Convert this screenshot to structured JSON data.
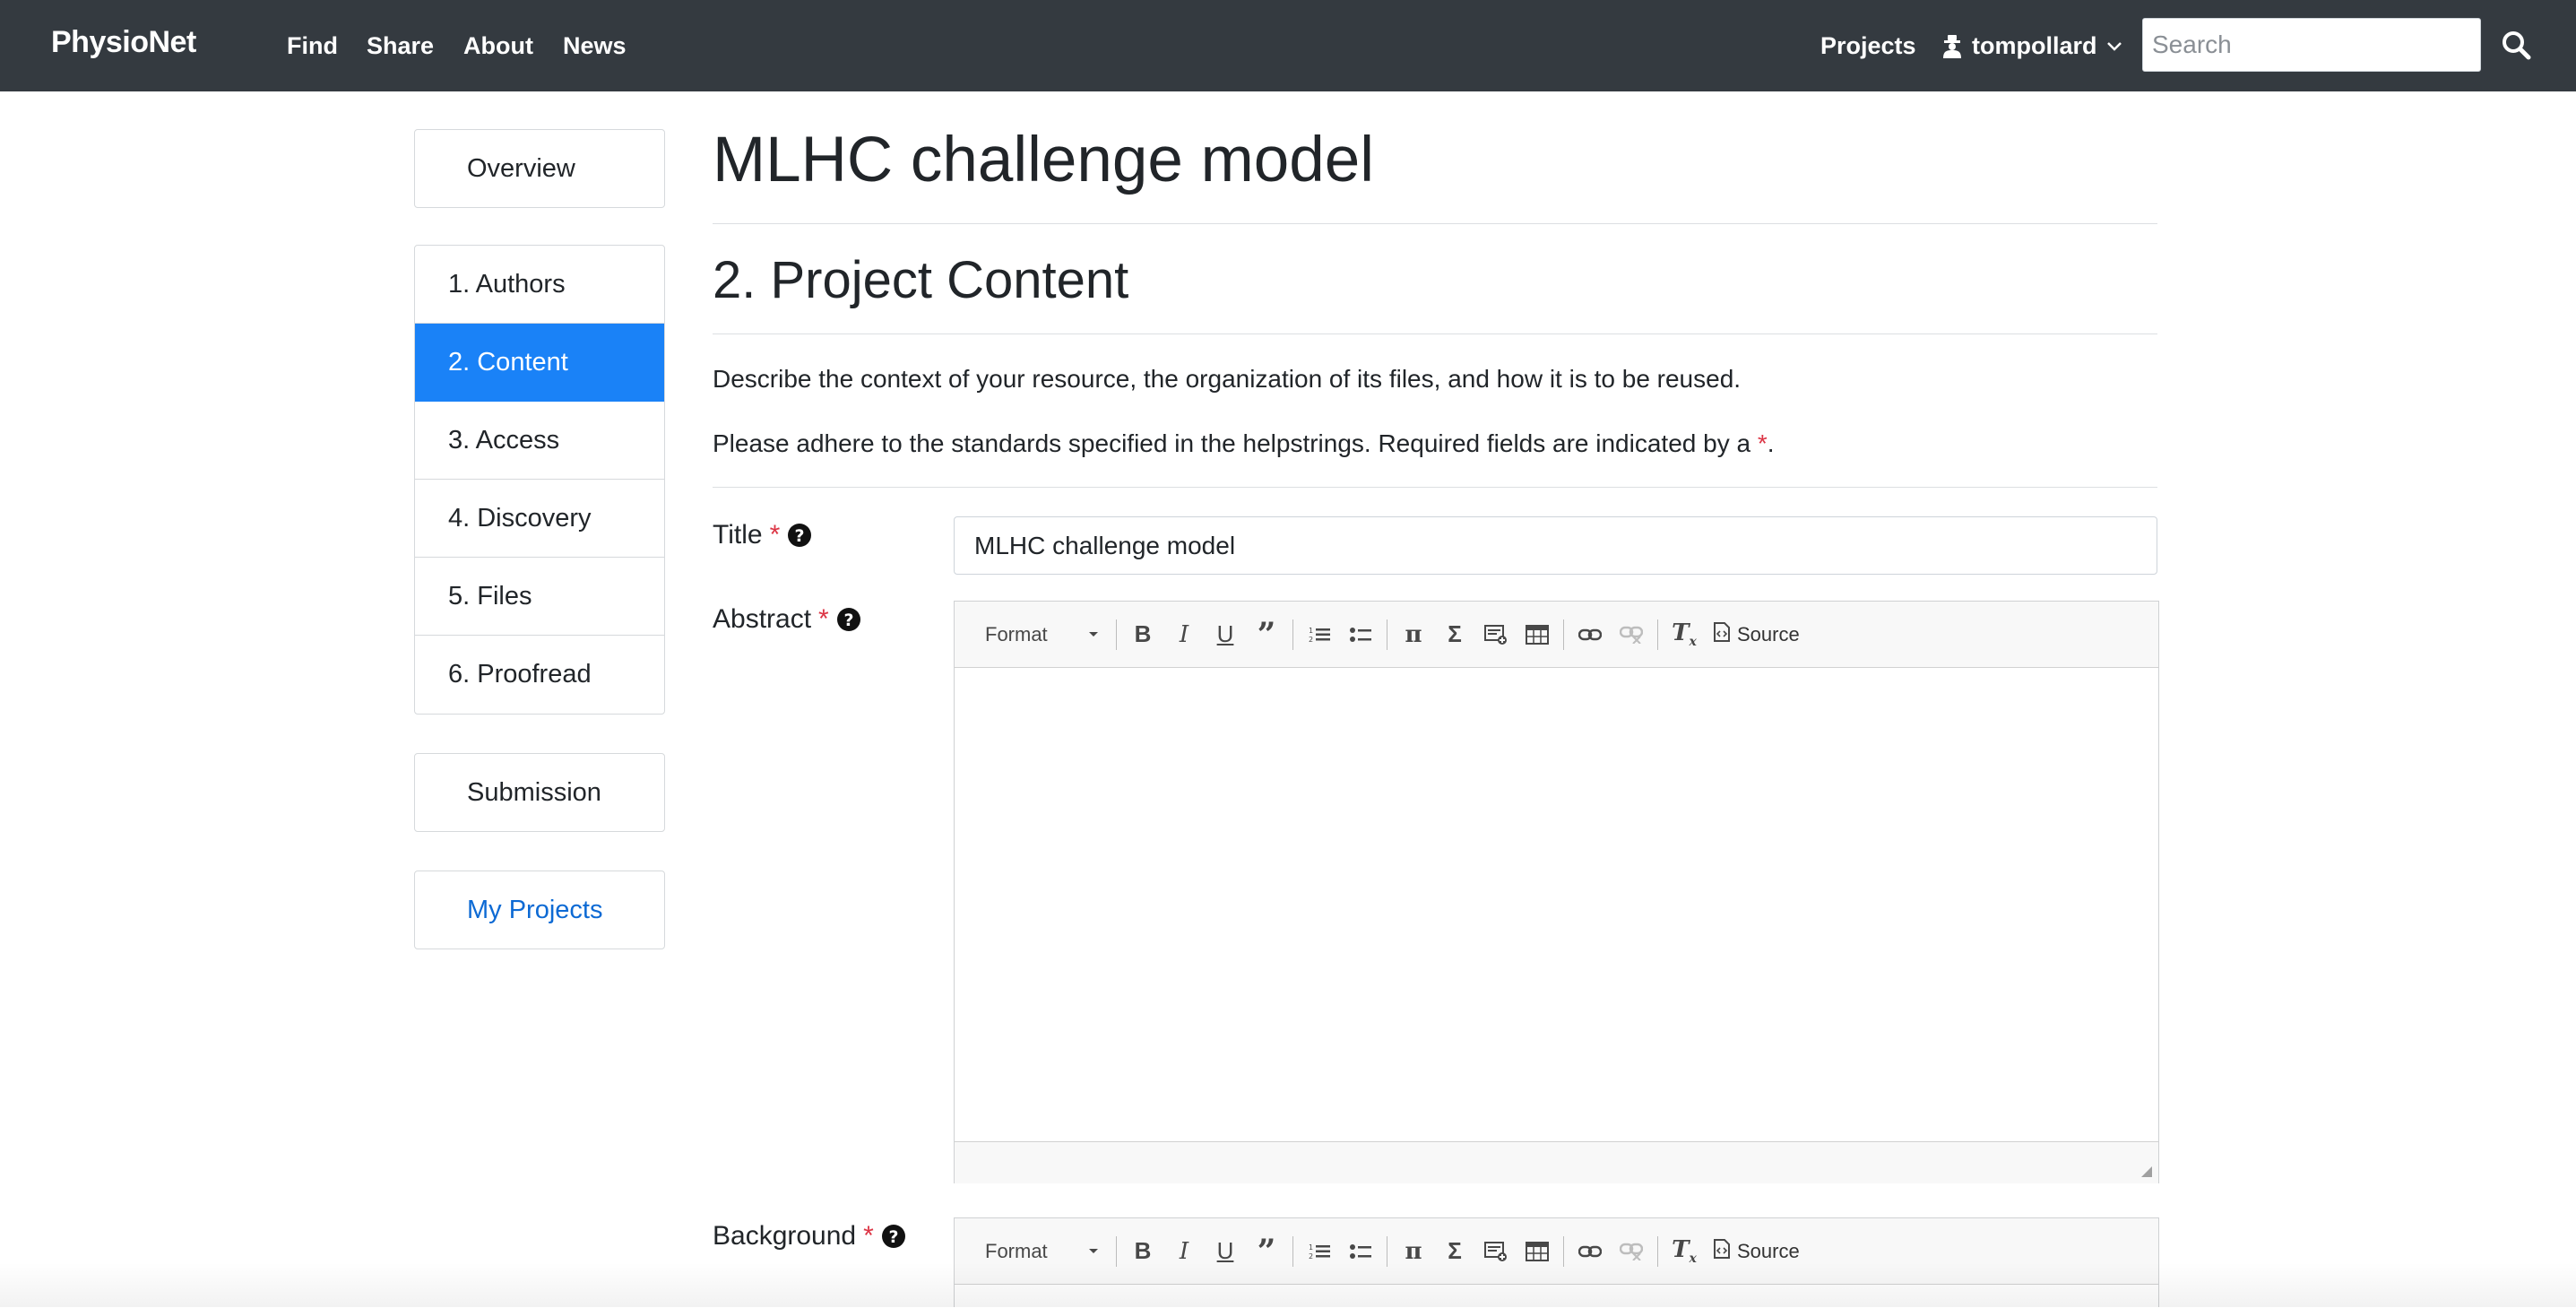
{
  "navbar": {
    "brand": "PhysioNet",
    "links": [
      "Find",
      "Share",
      "About",
      "News"
    ],
    "projects_label": "Projects",
    "username": "tompollard",
    "search_placeholder": "Search"
  },
  "sidebar": {
    "overview_label": "Overview",
    "steps": [
      "1. Authors",
      "2. Content",
      "3. Access",
      "4. Discovery",
      "5. Files",
      "6. Proofread"
    ],
    "active_step": "2. Content",
    "submission_label": "Submission",
    "my_projects_label": "My Projects"
  },
  "main": {
    "project_title": "MLHC challenge model",
    "section_title": "2. Project Content",
    "description": "Describe the context of your resource, the organization of its files, and how it is to be reused.",
    "instructions_prefix": "Please adhere to the standards specified in the helpstrings. Required fields are indicated by a ",
    "required_marker": "*",
    "instructions_suffix": "."
  },
  "fields": {
    "title": {
      "label": "Title",
      "value": "MLHC challenge model"
    },
    "abstract": {
      "label": "Abstract"
    },
    "background": {
      "label": "Background"
    }
  },
  "editor": {
    "format_label": "Format",
    "source_label": "Source",
    "tools": [
      "bold",
      "italic",
      "underline",
      "blockquote",
      "numbered-list",
      "bulleted-list",
      "math",
      "sigma",
      "insert-snippet",
      "table",
      "link",
      "unlink",
      "remove-format"
    ]
  },
  "colors": {
    "navbar_bg": "#343a40",
    "active_step_bg": "#1a82f7",
    "link_blue": "#0d6ad4",
    "required_red": "#dc3545"
  }
}
